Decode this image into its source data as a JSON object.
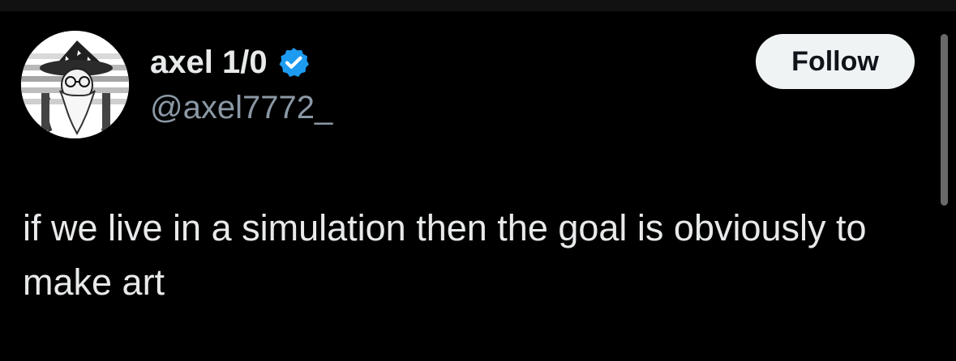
{
  "profile": {
    "display_name": "axel 1/0",
    "handle": "@axel7772_"
  },
  "actions": {
    "follow_label": "Follow"
  },
  "post": {
    "text": "if we live in a simulation then the goal is obviously to make art"
  },
  "icons": {
    "verified": "verified-badge-icon",
    "avatar": "wizard-avatar"
  },
  "colors": {
    "background": "#000000",
    "text_primary": "#e7e9ea",
    "text_secondary": "#8b98a5",
    "button_bg": "#eff3f4",
    "button_text": "#0f1419",
    "verified_blue": "#1d9bf0"
  }
}
